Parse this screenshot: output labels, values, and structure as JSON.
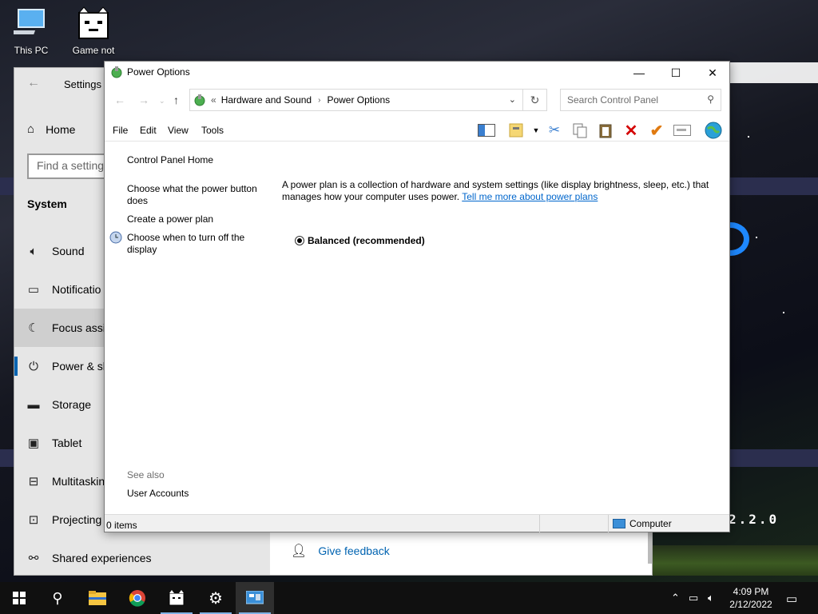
{
  "desktop": {
    "icons": [
      {
        "label": "This PC",
        "icon": "computer-icon"
      },
      {
        "label": "Game not",
        "icon": "cat-game-icon"
      }
    ],
    "background_text": "2.2.0"
  },
  "settings": {
    "title": "Settings",
    "home_label": "Home",
    "search_placeholder": "Find a setting",
    "section_label": "System",
    "items": [
      {
        "label": "Sound",
        "icon": "speaker-icon"
      },
      {
        "label": "Notificatio",
        "icon": "notification-icon"
      },
      {
        "label": "Focus assis",
        "icon": "moon-icon"
      },
      {
        "label": "Power & sl",
        "icon": "power-icon"
      },
      {
        "label": "Storage",
        "icon": "storage-icon"
      },
      {
        "label": "Tablet",
        "icon": "tablet-icon"
      },
      {
        "label": "Multitaskin",
        "icon": "multitasking-icon"
      },
      {
        "label": "Projecting",
        "icon": "projector-icon"
      },
      {
        "label": "Shared experiences",
        "icon": "shared-icon"
      }
    ],
    "feedback_label": "Give feedback"
  },
  "power": {
    "title": "Power Options",
    "address": {
      "overflow": "«",
      "crumbs": [
        "Hardware and Sound",
        "Power Options"
      ]
    },
    "search_placeholder": "Search Control Panel",
    "menu": [
      "File",
      "Edit",
      "View",
      "Tools"
    ],
    "left_pane": {
      "home": "Control Panel Home",
      "links": [
        "Choose what the power button does",
        "Create a power plan",
        "Choose when to turn off the display"
      ],
      "see_also_label": "See also",
      "see_also": [
        "User Accounts"
      ]
    },
    "description": "A power plan is a collection of hardware and system settings (like display brightness, sleep, etc.) that manages how your computer uses power.",
    "learn_more": "Tell me more about power plans",
    "plan": {
      "label": "Balanced (recommended)",
      "selected": true
    },
    "status": {
      "items": "0 items",
      "location": "Computer"
    }
  },
  "taskbar": {
    "apps": [
      "start-icon",
      "search-icon",
      "file-explorer-icon",
      "chrome-icon",
      "cat-game-icon",
      "settings-gear-icon",
      "control-panel-icon"
    ],
    "time": "4:09 PM",
    "date": "2/12/2022"
  },
  "colors": {
    "accent": "#0063b1",
    "link": "#0066cc",
    "taskbar": "#101010",
    "delete_red": "#d40000",
    "check_orange": "#e07a10"
  }
}
